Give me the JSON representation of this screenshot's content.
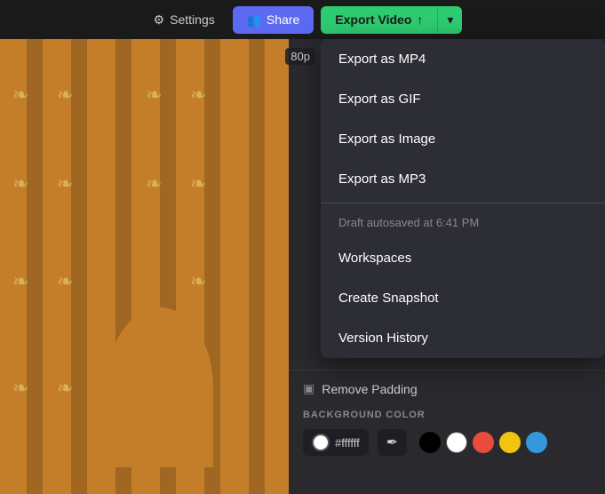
{
  "topbar": {
    "settings_label": "Settings",
    "share_label": "Share",
    "export_video_label": "Export Video",
    "resolution": "80p"
  },
  "dropdown": {
    "items": [
      {
        "id": "export-mp4",
        "label": "Export as MP4"
      },
      {
        "id": "export-gif",
        "label": "Export as GIF"
      },
      {
        "id": "export-image",
        "label": "Export as Image"
      },
      {
        "id": "export-mp3",
        "label": "Export as MP3"
      }
    ],
    "autosaved_text": "Draft autosaved at 6:41 PM",
    "workspaces_label": "Workspaces",
    "create_snapshot_label": "Create Snapshot",
    "version_history_label": "Version History"
  },
  "bottom_panel": {
    "remove_padding_label": "Remove Padding",
    "bg_color_label": "BACKGROUND COLOR",
    "color_hex": "#ffffff",
    "color_swatches": [
      "#000000",
      "#ffffff",
      "#e74c3c",
      "#f1c40f",
      "#3498db"
    ]
  }
}
